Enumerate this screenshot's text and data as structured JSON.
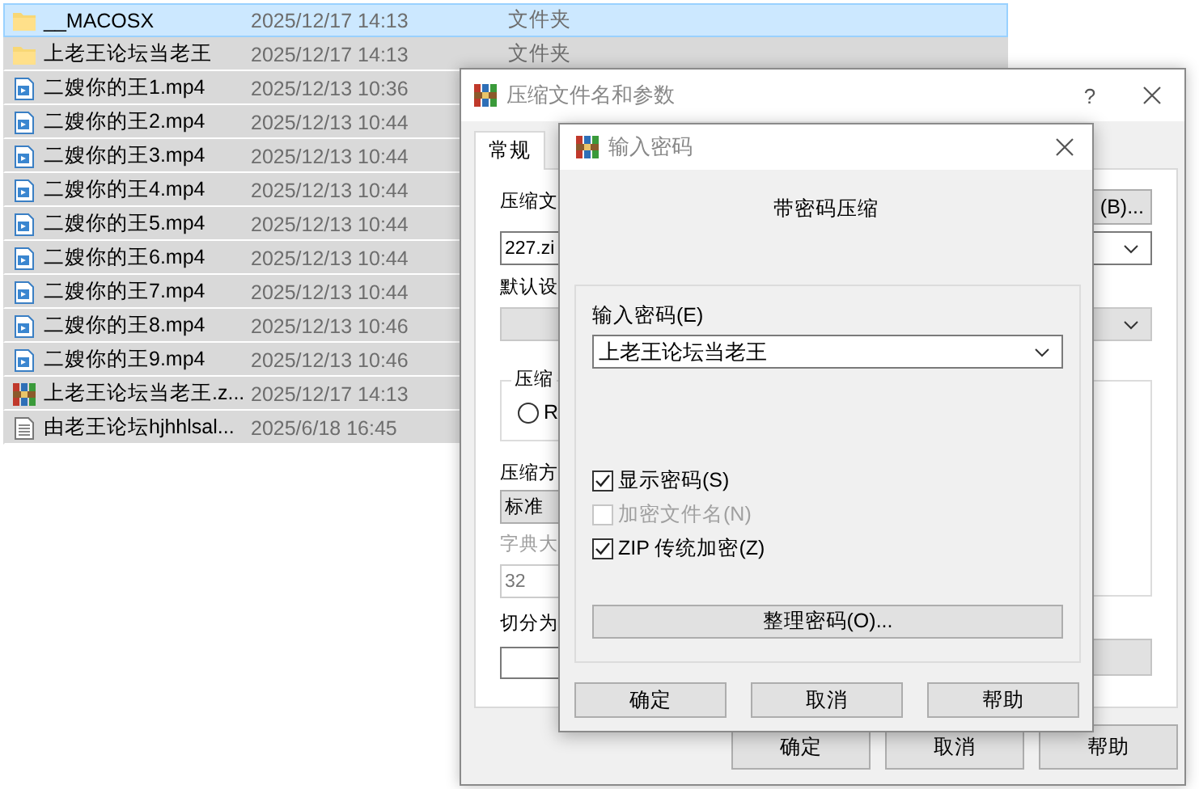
{
  "file_list": {
    "rows": [
      {
        "kind": "folder",
        "name": "__MACOSX",
        "date": "2025/12/17 14:13",
        "type": "文件夹",
        "selected": true,
        "focused": true
      },
      {
        "kind": "folder",
        "name": "上老王论坛当老王",
        "date": "2025/12/17 14:13",
        "type": "文件夹",
        "selected": true,
        "focused": false
      },
      {
        "kind": "video",
        "name": "二嫂你的王1.mp4",
        "date": "2025/12/13 10:36",
        "selected": true,
        "focused": false
      },
      {
        "kind": "video",
        "name": "二嫂你的王2.mp4",
        "date": "2025/12/13 10:44",
        "selected": true,
        "focused": false
      },
      {
        "kind": "video",
        "name": "二嫂你的王3.mp4",
        "date": "2025/12/13 10:44",
        "selected": true,
        "focused": false
      },
      {
        "kind": "video",
        "name": "二嫂你的王4.mp4",
        "date": "2025/12/13 10:44",
        "selected": true,
        "focused": false
      },
      {
        "kind": "video",
        "name": "二嫂你的王5.mp4",
        "date": "2025/12/13 10:44",
        "selected": true,
        "focused": false
      },
      {
        "kind": "video",
        "name": "二嫂你的王6.mp4",
        "date": "2025/12/13 10:44",
        "selected": true,
        "focused": false
      },
      {
        "kind": "video",
        "name": "二嫂你的王7.mp4",
        "date": "2025/12/13 10:44",
        "selected": true,
        "focused": false
      },
      {
        "kind": "video",
        "name": "二嫂你的王8.mp4",
        "date": "2025/12/13 10:46",
        "selected": true,
        "focused": false
      },
      {
        "kind": "video",
        "name": "二嫂你的王9.mp4",
        "date": "2025/12/13 10:46",
        "selected": true,
        "focused": false
      },
      {
        "kind": "archive",
        "name": "上老王论坛当老王.z...",
        "date": "2025/12/17 14:13",
        "selected": true,
        "focused": false
      },
      {
        "kind": "text",
        "name": "由老王论坛hjhhlsal...",
        "date": "2025/6/18 16:45",
        "selected": true,
        "focused": false
      }
    ]
  },
  "archive_dialog": {
    "title": "压缩文件名和参数",
    "help": "?",
    "tabs": [
      {
        "label": "常规",
        "selected": true
      }
    ],
    "archive_name_label": "压缩文",
    "browse_button": "(B)...",
    "archive_name_value": "227.zi",
    "profile_label": "默认设",
    "format_group_label": "压缩",
    "format_option": {
      "label": "R",
      "selected": false
    },
    "method_label": "压缩方",
    "method_value": "标准",
    "dictionary": {
      "label": "字典大",
      "value": "32",
      "disabled": true
    },
    "split_label": "切分为",
    "buttons": [
      "确定",
      "取消",
      "帮助"
    ]
  },
  "password_dialog": {
    "title": "输入密码",
    "heading": "带密码压缩",
    "password_label": "输入密码(E)",
    "password_value": "上老王论坛当老王",
    "options": [
      {
        "label": "显示密码(S)",
        "checked": true,
        "disabled": false
      },
      {
        "label": "加密文件名(N)",
        "checked": false,
        "disabled": true
      },
      {
        "label": "ZIP 传统加密(Z)",
        "checked": true,
        "disabled": false
      }
    ],
    "manage_button": "整理密码(O)...",
    "buttons": [
      "确定",
      "取消",
      "帮助"
    ]
  }
}
